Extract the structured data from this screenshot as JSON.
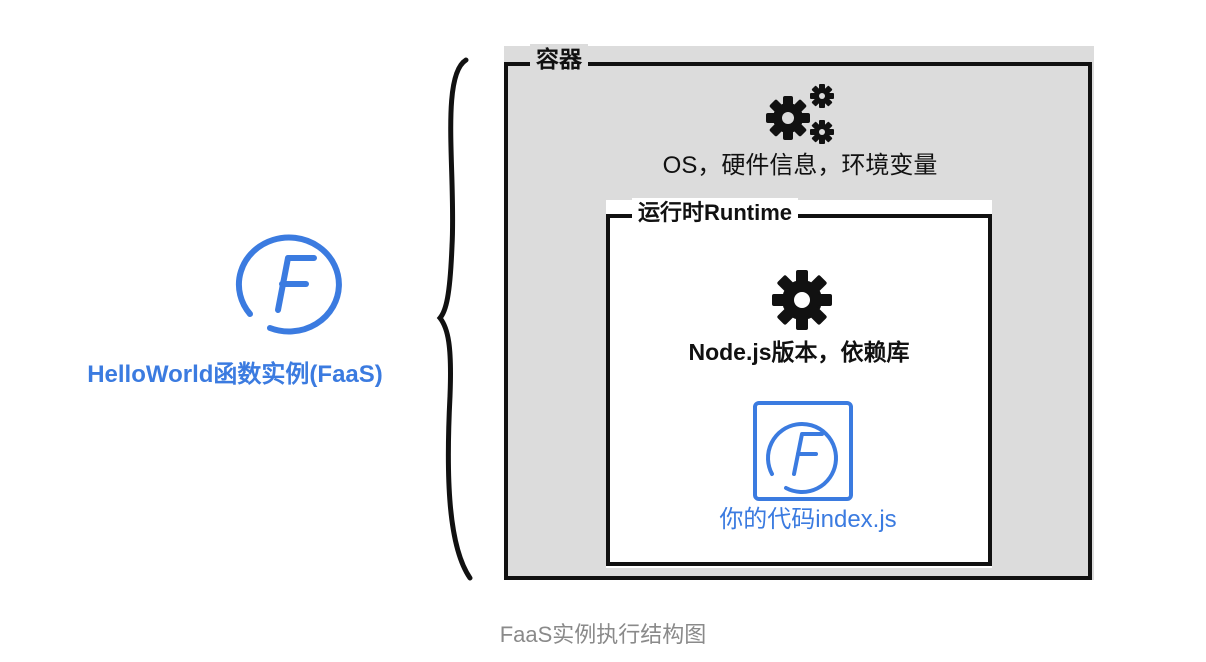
{
  "left": {
    "logo_icon": "faas-logo-icon",
    "label": "HelloWorld函数实例(FaaS)"
  },
  "container": {
    "label": "容器",
    "icon": "gears-icon",
    "description": "OS，硬件信息，环境变量"
  },
  "runtime": {
    "label": "运行时Runtime",
    "icon": "gear-icon",
    "description": "Node.js版本，依赖库",
    "code": {
      "icon": "faas-code-icon",
      "label": "你的代码index.js"
    }
  },
  "caption": "FaaS实例执行结构图",
  "colors": {
    "accent_blue": "#3b7be0",
    "container_gray": "#dcdcdc",
    "ink": "#111111",
    "caption_gray": "#8a8a8a"
  }
}
